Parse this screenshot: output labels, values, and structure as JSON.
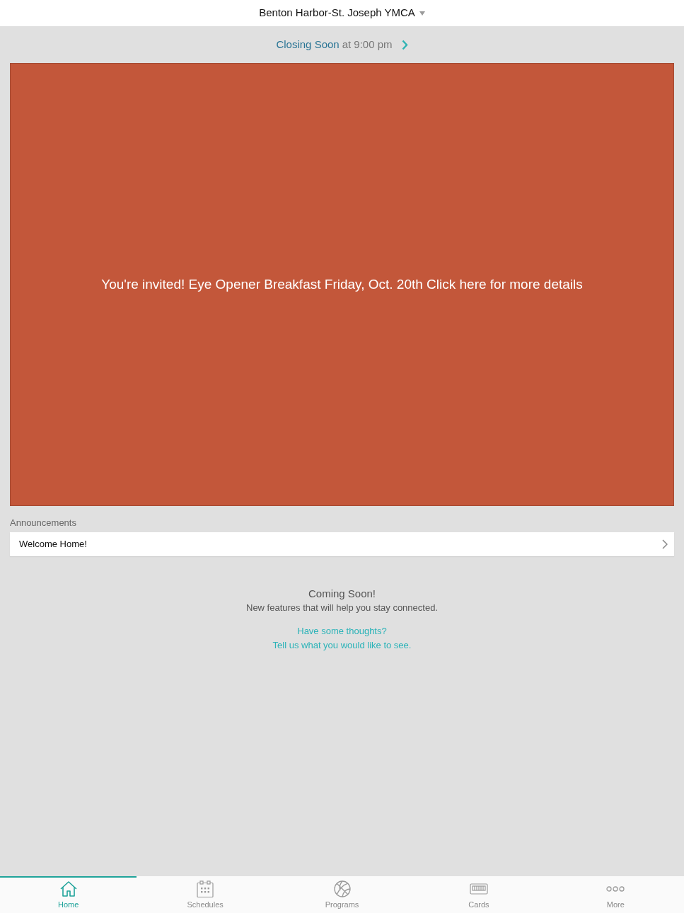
{
  "header": {
    "title": "Benton Harbor-St. Joseph YMCA"
  },
  "hours": {
    "status": "Closing Soon",
    "detail": "at 9:00 pm"
  },
  "banner": {
    "text": "You're invited! Eye Opener Breakfast Friday, Oct. 20th Click here for more details"
  },
  "announcements": {
    "heading": "Announcements",
    "items": [
      {
        "title": "Welcome Home!"
      }
    ]
  },
  "coming_soon": {
    "title": "Coming Soon!",
    "subtitle": "New features that will help you stay connected.",
    "links": [
      "Have some thoughts?",
      "Tell us what you would like to see."
    ]
  },
  "tabs": [
    {
      "label": "Home",
      "kind": "home",
      "selected": true
    },
    {
      "label": "Schedules",
      "kind": "schedules",
      "selected": false
    },
    {
      "label": "Programs",
      "kind": "programs",
      "selected": false
    },
    {
      "label": "Cards",
      "kind": "cards",
      "selected": false
    },
    {
      "label": "More",
      "kind": "more",
      "selected": false
    }
  ]
}
